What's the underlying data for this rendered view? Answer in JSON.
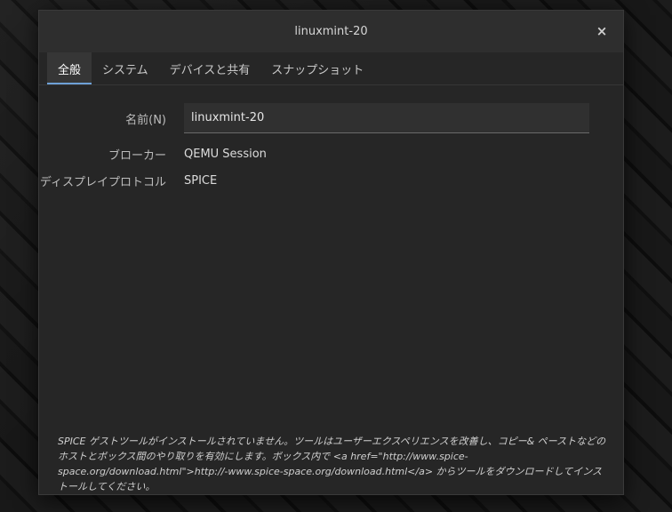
{
  "window": {
    "title": "linuxmint-20",
    "close_label": "×"
  },
  "tabs": [
    {
      "label": "全般",
      "active": true
    },
    {
      "label": "システム",
      "active": false
    },
    {
      "label": "デバイスと共有",
      "active": false
    },
    {
      "label": "スナップショット",
      "active": false
    }
  ],
  "general": {
    "name_label": "名前(N)",
    "name_value": "linuxmint-20",
    "broker_label": "ブローカー",
    "broker_value": "QEMU Session",
    "protocol_label": "ディスプレイプロトコル",
    "protocol_value": "SPICE"
  },
  "note": {
    "text": "SPICE ゲストツールがインストールされていません。ツールはユーザーエクスペリエンスを改善し、コピー& ペーストなどのホストとボックス間のやり取りを有効にします。ボックス内で <a href=\"http://www.spice-space.org/download.html\">http://-www.spice-space.org/download.html</a> からツールをダウンロードしてインストールしてください。"
  }
}
